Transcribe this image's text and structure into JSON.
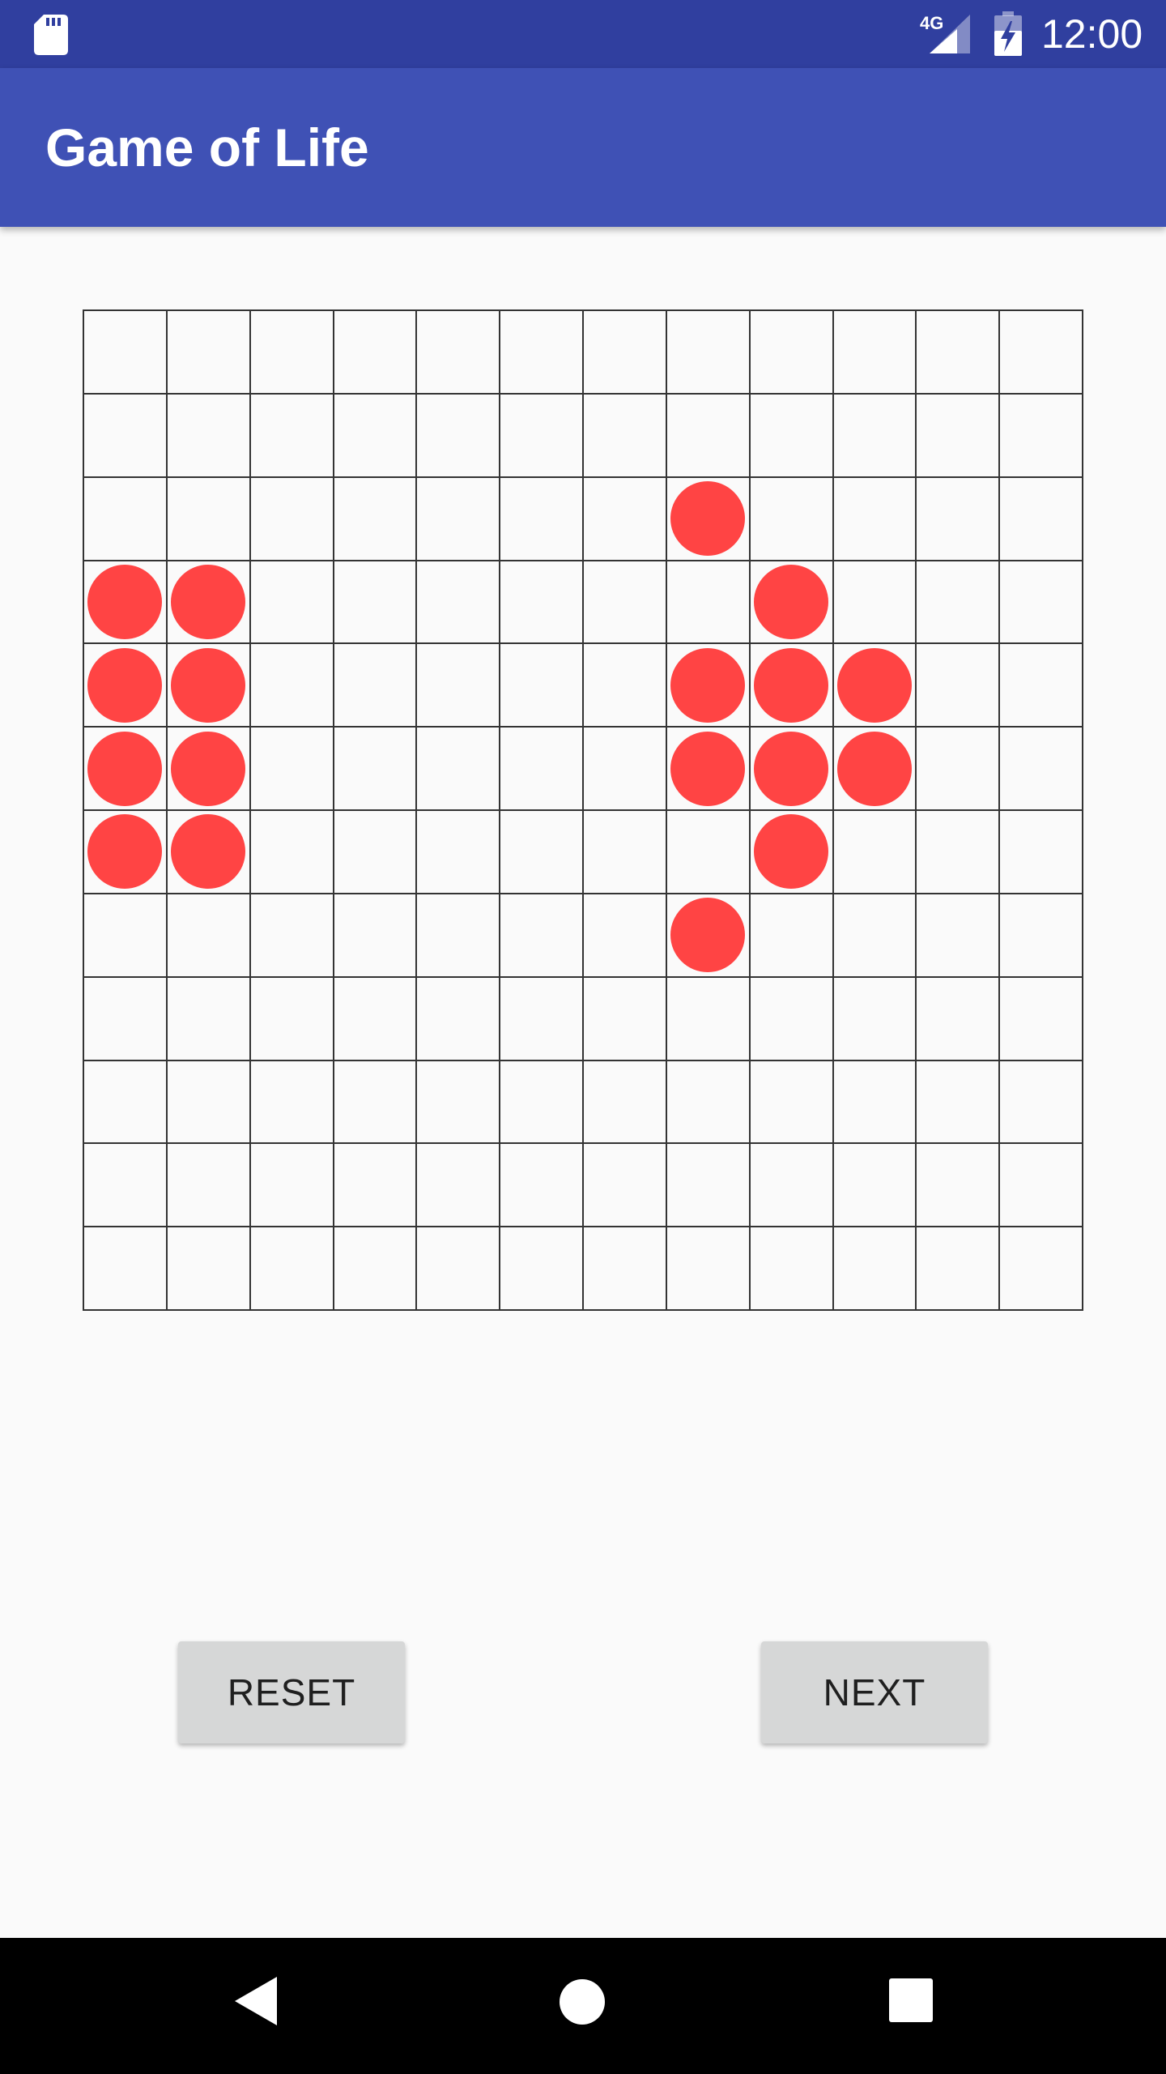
{
  "status_bar": {
    "time": "12:00",
    "network": "4G",
    "icons": [
      "sd-card-icon",
      "signal-4g-icon",
      "battery-charging-icon"
    ],
    "background": "#303f9f"
  },
  "app_bar": {
    "title": "Game of Life",
    "background": "#3f51b5"
  },
  "board": {
    "rows": 12,
    "cols": 12,
    "live_color": "#ff4444",
    "live_cells": [
      [
        2,
        7
      ],
      [
        3,
        0
      ],
      [
        3,
        1
      ],
      [
        3,
        8
      ],
      [
        4,
        0
      ],
      [
        4,
        1
      ],
      [
        4,
        7
      ],
      [
        4,
        8
      ],
      [
        4,
        9
      ],
      [
        5,
        0
      ],
      [
        5,
        1
      ],
      [
        5,
        7
      ],
      [
        5,
        8
      ],
      [
        5,
        9
      ],
      [
        6,
        0
      ],
      [
        6,
        1
      ],
      [
        6,
        8
      ],
      [
        7,
        7
      ]
    ]
  },
  "controls": {
    "reset_label": "RESET",
    "next_label": "NEXT"
  },
  "nav_bar": {
    "icons": [
      "back-icon",
      "home-icon",
      "recents-icon"
    ]
  }
}
